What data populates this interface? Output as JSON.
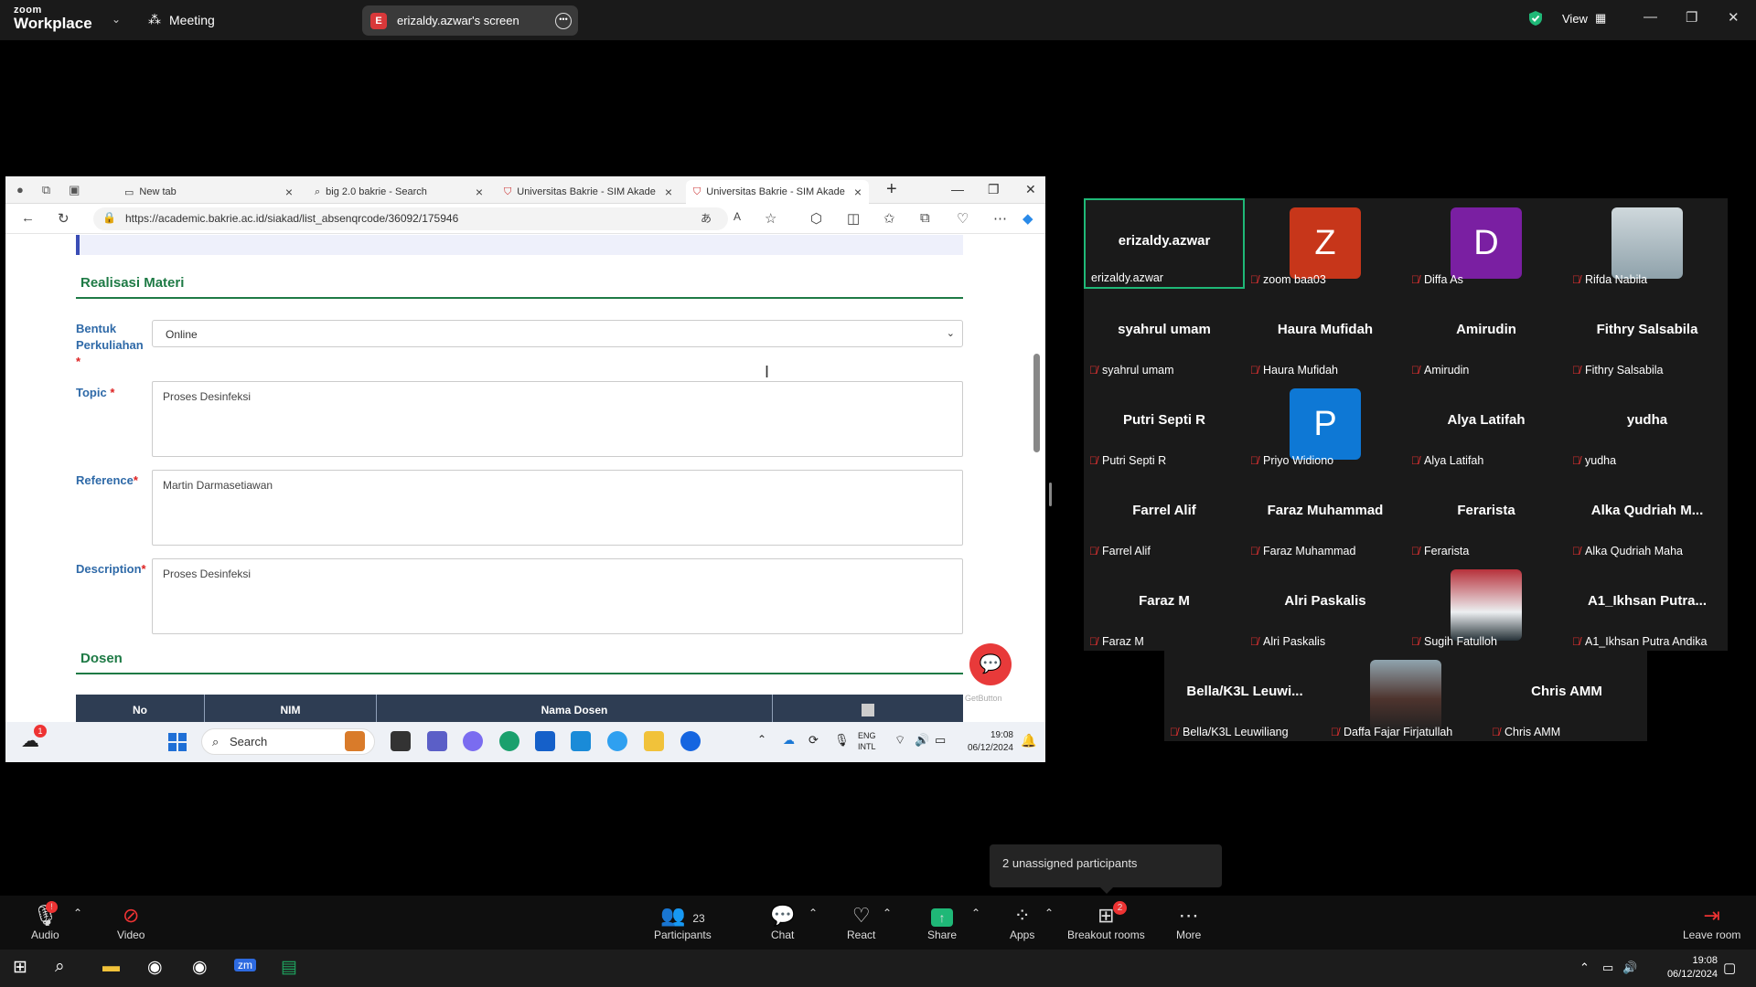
{
  "zoom": {
    "logo_line1": "zoom",
    "logo_line2": "Workplace",
    "meeting_label": "Meeting",
    "screen_pill": {
      "badge": "E",
      "label": "erizaldy.azwar's screen"
    },
    "view_label": "View",
    "accent_green": "#1fb877"
  },
  "browser": {
    "tabs": [
      {
        "label": "New tab"
      },
      {
        "label": "big 2.0 bakrie - Search"
      },
      {
        "label": "Universitas Bakrie - SIM Akadem"
      },
      {
        "label": "Universitas Bakrie - SIM Akadem"
      }
    ],
    "url": "https://academic.bakrie.ac.id/siakad/list_absenqrcode/36092/175946",
    "page": {
      "section1_title": "Realisasi Materi",
      "bentuk_label_1": "Bentuk",
      "bentuk_label_2": "Perkuliahan",
      "bentuk_value": "Online",
      "topic_label": "Topic",
      "topic_value": "Proses Desinfeksi",
      "reference_label": "Reference",
      "reference_value": "Martin Darmasetiawan",
      "description_label": "Description",
      "description_value": "Proses Desinfeksi",
      "section2_title": "Dosen",
      "table_headers": [
        "No",
        "NIM",
        "Nama Dosen",
        ""
      ],
      "getbutton_label": "GetButton",
      "required_mark": "*"
    }
  },
  "shared_taskbar": {
    "weather_badge": "1",
    "search_placeholder": "Search",
    "lang_line1": "ENG",
    "lang_line2": "INTL",
    "time": "19:08",
    "date": "06/12/2024"
  },
  "participants": [
    {
      "display": "erizaldy.azwar",
      "label": "erizaldy.azwar",
      "avatar": "",
      "muted": false
    },
    {
      "display": "",
      "label": "zoom baa03",
      "avatar": "Z",
      "avatar_color": "#c7361a",
      "muted": true
    },
    {
      "display": "",
      "label": "Diffa As",
      "avatar": "D",
      "avatar_color": "#7a1fa2",
      "muted": true
    },
    {
      "display": "",
      "label": "Rifda Nabila",
      "avatar": "",
      "photo": true,
      "muted": true
    },
    {
      "display": "syahrul umam",
      "label": "syahrul umam",
      "avatar": "",
      "muted": true
    },
    {
      "display": "Haura Mufidah",
      "label": "Haura Mufidah",
      "avatar": "",
      "muted": true
    },
    {
      "display": "Amirudin",
      "label": "Amirudin",
      "avatar": "",
      "muted": true
    },
    {
      "display": "Fithry Salsabila",
      "label": "Fithry Salsabila",
      "avatar": "",
      "muted": true
    },
    {
      "display": "Putri Septi R",
      "label": "Putri Septi R",
      "avatar": "",
      "muted": true
    },
    {
      "display": "",
      "label": "Priyo Widiono",
      "avatar": "P",
      "avatar_color": "#0e78d5",
      "muted": true
    },
    {
      "display": "Alya Latifah",
      "label": "Alya Latifah",
      "avatar": "",
      "muted": true
    },
    {
      "display": "yudha",
      "label": "yudha",
      "avatar": "",
      "muted": true
    },
    {
      "display": "Farrel Alif",
      "label": "Farrel Alif",
      "avatar": "",
      "muted": true
    },
    {
      "display": "Faraz Muhammad",
      "label": "Faraz Muhammad",
      "avatar": "",
      "muted": true
    },
    {
      "display": "Ferarista",
      "label": "Ferarista",
      "avatar": "",
      "muted": true
    },
    {
      "display": "Alka Qudriah M...",
      "label": "Alka Qudriah Maha",
      "avatar": "",
      "muted": true
    },
    {
      "display": "Faraz M",
      "label": "Faraz M",
      "avatar": "",
      "muted": true
    },
    {
      "display": "Alri Paskalis",
      "label": "Alri Paskalis",
      "avatar": "",
      "muted": true
    },
    {
      "display": "",
      "label": "Sugih Fatulloh",
      "avatar": "",
      "photo": true,
      "muted": true
    },
    {
      "display": "A1_Ikhsan Putra...",
      "label": "A1_Ikhsan Putra Andika",
      "avatar": "",
      "muted": true
    },
    {
      "display": "Bella/K3L Leuwi...",
      "label": "Bella/K3L Leuwiliang",
      "avatar": "",
      "muted": true
    },
    {
      "display": "",
      "label": "Daffa Fajar Firjatullah",
      "avatar": "",
      "photo": true,
      "muted": true
    },
    {
      "display": "Chris AMM",
      "label": "Chris AMM",
      "avatar": "",
      "muted": true
    }
  ],
  "unassigned_tooltip": "2 unassigned participants",
  "controls": {
    "audio": "Audio",
    "audio_badge": "!",
    "video": "Video",
    "participants": "Participants",
    "participants_count": "23",
    "chat": "Chat",
    "react": "React",
    "share": "Share",
    "apps": "Apps",
    "breakout": "Breakout rooms",
    "breakout_badge": "2",
    "more": "More",
    "leave": "Leave room"
  },
  "windows_taskbar": {
    "time": "19:08",
    "date": "06/12/2024"
  }
}
